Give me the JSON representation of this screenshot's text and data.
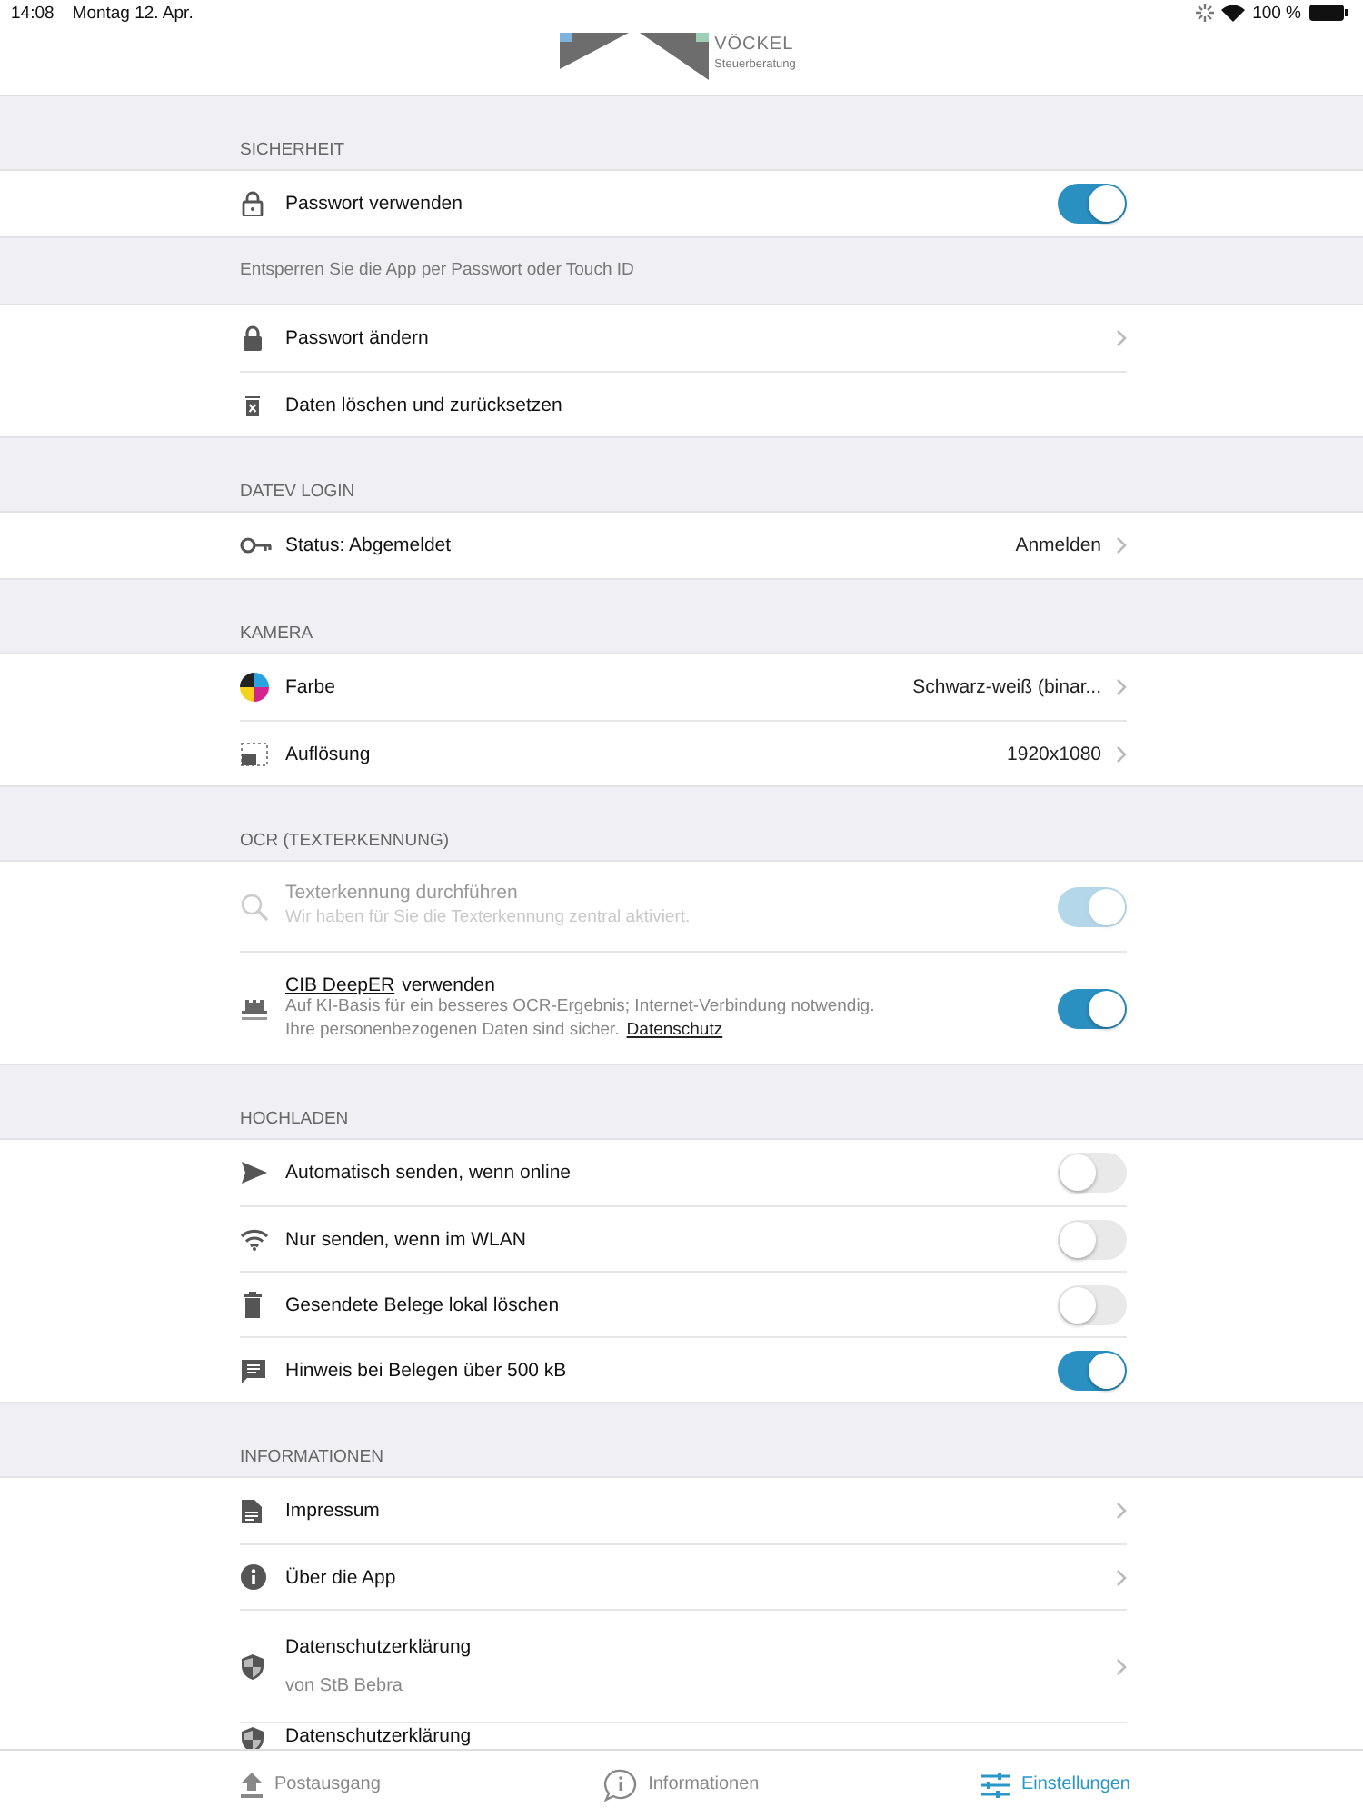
{
  "status_bar": {
    "time": "14:08",
    "date": "Montag 12. Apr.",
    "battery": "100 %"
  },
  "logo": {
    "name": "VÖCKEL",
    "tagline": "Steuerberatung"
  },
  "sections": [
    {
      "header": "SICHERHEIT",
      "footer": "Entsperren Sie die App per Passwort oder Touch ID",
      "rows": [
        {
          "kind": "toggle",
          "title": "Passwort verwenden",
          "on": true,
          "disabled": false
        }
      ]
    },
    {
      "rows": [
        {
          "kind": "link",
          "title": "Passwort ändern"
        },
        {
          "kind": "action",
          "title": "Daten löschen und zurücksetzen"
        }
      ]
    },
    {
      "header": "DATEV LOGIN",
      "rows": [
        {
          "kind": "link",
          "title": "Status: Abgemeldet",
          "value": "Anmelden"
        }
      ]
    },
    {
      "header": "KAMERA",
      "rows": [
        {
          "kind": "link",
          "title": "Farbe",
          "value": "Schwarz-weiß (binar..."
        },
        {
          "kind": "link",
          "title": "Auflösung",
          "value": "1920x1080"
        }
      ]
    },
    {
      "header": "OCR (TEXTERKENNUNG)",
      "rows": [
        {
          "kind": "toggle",
          "title": "Texterkennung durchführen",
          "description": [
            "Wir haben für Sie die Texterkennung zentral aktiviert."
          ],
          "on": true,
          "disabled": true
        },
        {
          "kind": "toggle",
          "title_link": "CIB DeepER",
          "title": "verwenden",
          "description": [
            "Auf KI-Basis für ein besseres OCR-Ergebnis; Internet-Verbindung notwendig.",
            "Ihre personenbezogenen Daten sind sicher."
          ],
          "link": "Datenschutz",
          "on": true,
          "disabled": false
        }
      ]
    },
    {
      "header": "HOCHLADEN",
      "rows": [
        {
          "kind": "toggle",
          "title": "Automatisch senden, wenn online",
          "on": false,
          "disabled": false
        },
        {
          "kind": "toggle",
          "title": "Nur senden, wenn im WLAN",
          "on": false,
          "disabled": false
        },
        {
          "kind": "toggle",
          "title": "Gesendete Belege lokal löschen",
          "on": false,
          "disabled": false
        },
        {
          "kind": "toggle",
          "title": "Hinweis bei Belegen über 500 kB",
          "on": true,
          "disabled": false
        }
      ]
    },
    {
      "header": "INFORMATIONEN",
      "rows": [
        {
          "kind": "link",
          "title": "Impressum"
        },
        {
          "kind": "link",
          "title": "Über die App"
        },
        {
          "kind": "link",
          "title": "Datenschutzerklärung",
          "subtitle": "von StB Bebra"
        },
        {
          "kind": "cut",
          "title": "Datenschutzerklärung"
        }
      ]
    }
  ],
  "tabs": [
    {
      "label": "Postausgang",
      "selected": false
    },
    {
      "label": "Informationen",
      "selected": false
    },
    {
      "label": "Einstellungen",
      "selected": true
    }
  ]
}
